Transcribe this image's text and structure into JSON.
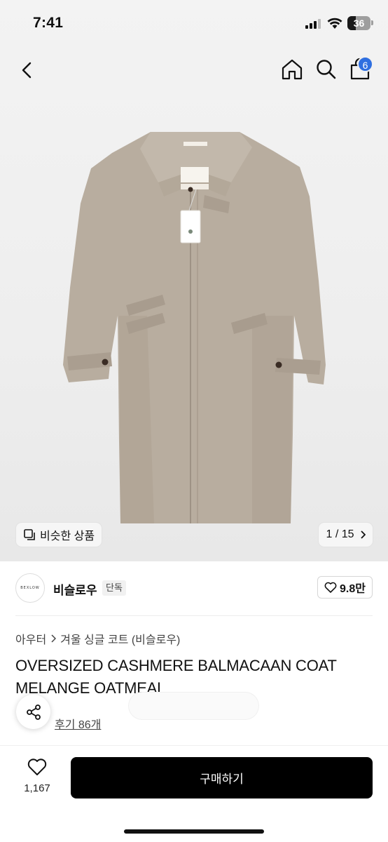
{
  "status_bar": {
    "time": "7:41",
    "battery": "36"
  },
  "nav": {
    "cart_count": "6"
  },
  "icons": {
    "back": "chevron-left-icon",
    "home": "home-icon",
    "search": "search-icon",
    "cart": "shopping-bag-icon",
    "share": "share-icon",
    "heart": "heart-icon",
    "similar": "copy-icon"
  },
  "gallery": {
    "similar_label": "비슷한 상품",
    "page_indicator": "1 / 15"
  },
  "brand": {
    "logo_text": "BEXLOW",
    "name": "비슬로우",
    "tag": "단독",
    "likes": "9.8만"
  },
  "breadcrumb": {
    "category": "아우터",
    "subcategory": "겨울 싱글 코트 (비슬로우)"
  },
  "product": {
    "title": "OVERSIZED CASHMERE BALMACAAN COAT MELANGE OATMEAL",
    "review_link": "후기 86개"
  },
  "bottom": {
    "wish_count": "1,167",
    "buy_label": "구매하기"
  },
  "colors": {
    "accent_badge": "#2f6fe0",
    "buy_button": "#000000",
    "coat": "#b5aa9d"
  }
}
